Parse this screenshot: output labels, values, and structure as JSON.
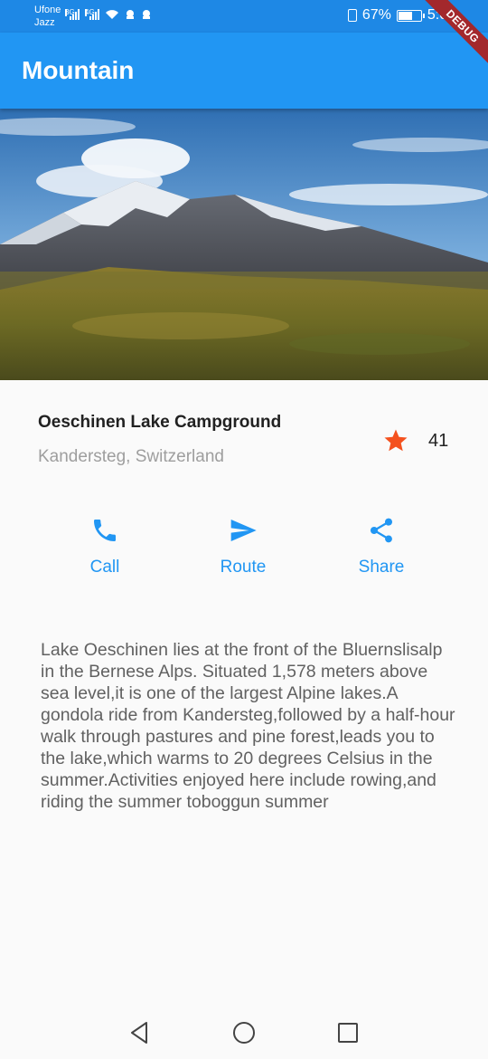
{
  "status_bar": {
    "carrier_1": "Ufone",
    "carrier_2": "Jazz",
    "net_1": "3G",
    "net_2": "4G",
    "battery": "67%",
    "battery_level": 0.67,
    "time": "5:00"
  },
  "debug_banner": "DEBUG",
  "app_bar": {
    "title": "Mountain"
  },
  "place": {
    "name": "Oeschinen Lake Campground",
    "location": "Kandersteg, Switzerland",
    "rating": "41",
    "star_icon": "star-icon"
  },
  "actions": [
    {
      "label": "Call",
      "icon": "phone-icon"
    },
    {
      "label": "Route",
      "icon": "send-icon"
    },
    {
      "label": "Share",
      "icon": "share-icon"
    }
  ],
  "description": "Lake Oeschinen lies at the front of the Bluernslisalp in the Bernese Alps. Situated 1,578 meters above sea level,it is one of the largest Alpine lakes.A gondola ride from Kandersteg,followed by a half-hour walk through pastures and pine forest,leads you to the lake,which warms to 20 degrees Celsius in the summer.Activities enjoyed here include rowing,and riding the summer toboggun summer",
  "nav": {
    "back_icon": "back-triangle-icon",
    "home_icon": "home-circle-icon",
    "recent_icon": "recent-square-icon"
  },
  "colors": {
    "accent": "#2196f3",
    "status_bar": "#1e88e5",
    "star": "#f4511e",
    "debug": "#a3282c"
  }
}
